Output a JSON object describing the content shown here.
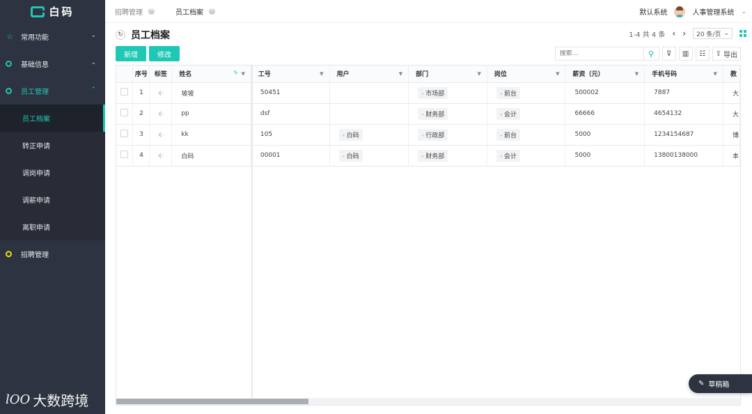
{
  "brand": {
    "name": "白码"
  },
  "watermark": {
    "text": "大数跨境",
    "logo": "lOO"
  },
  "sidebar": {
    "groups": [
      {
        "label": "常用功能",
        "icon": "star-icon",
        "expanded": false
      },
      {
        "label": "基础信息",
        "icon": "circle-icon",
        "expanded": false
      },
      {
        "label": "员工管理",
        "icon": "circle-icon",
        "expanded": true,
        "children": [
          "员工档案",
          "转正申请",
          "调岗申请",
          "调薪申请",
          "离职申请"
        ]
      },
      {
        "label": "招聘管理",
        "icon": "circle-icon",
        "expanded": false
      }
    ],
    "current": "员工档案"
  },
  "topbar": {
    "tabs": [
      {
        "label": "招聘管理"
      },
      {
        "label": "员工档案"
      }
    ],
    "system": "默认系统",
    "app": "人事管理系统"
  },
  "page": {
    "title": "员工档案",
    "pager_text": "1-4 共 4 条",
    "page_size": "20 条/页",
    "add_label": "新增",
    "edit_label": "修改",
    "search_placeholder": "搜索...",
    "export_label": "导出"
  },
  "table": {
    "headers": {
      "idx": "序号",
      "tag": "标签",
      "name": "姓名",
      "no": "工号",
      "user": "用户",
      "dept": "部门",
      "post": "岗位",
      "salary": "薪资（元）",
      "phone": "手机号码",
      "edu": "教"
    },
    "rows": [
      {
        "idx": "1",
        "name": "坡坡",
        "no": "50451",
        "user": "",
        "dept": "市场部",
        "post": "前台",
        "salary": "500002",
        "phone": "7887",
        "edu": "大"
      },
      {
        "idx": "2",
        "name": "pp",
        "no": "dsf",
        "user": "",
        "dept": "财务部",
        "post": "会计",
        "salary": "66666",
        "phone": "4654132",
        "edu": "大"
      },
      {
        "idx": "3",
        "name": "kk",
        "no": "105",
        "user": "白码",
        "dept": "行政部",
        "post": "前台",
        "salary": "5000",
        "phone": "1234154687",
        "edu": "博"
      },
      {
        "idx": "4",
        "name": "白码",
        "no": "00001",
        "user": "白码",
        "dept": "财务部",
        "post": "会计",
        "salary": "5000",
        "phone": "13800138000",
        "edu": "本"
      }
    ]
  },
  "draft": {
    "label": "草稿箱"
  },
  "colors": {
    "accent": "#1fc8b4",
    "sidebar": "#2d3340"
  }
}
